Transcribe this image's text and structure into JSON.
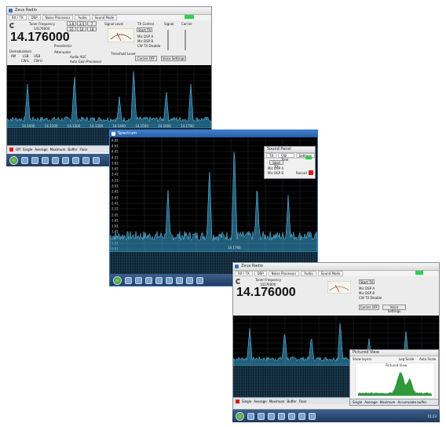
{
  "window1": {
    "title": "Zeus Radio",
    "menus": [
      "RX / TX",
      "DSP",
      "Noise Processor",
      "Audio",
      "Sound Mode"
    ],
    "tuner_label": "Tuner Frequency",
    "tuner_sub": "14176000",
    "frequency": "14.176000",
    "demodulation_label": "Demodulators",
    "modes": [
      "AM",
      "LSB",
      "USB",
      "CW-L",
      "CW-U"
    ],
    "bands": [
      "1.8",
      "3.5",
      "7",
      "10",
      "14",
      "18",
      "21",
      "24",
      "28"
    ],
    "signal_level_label": "Signal Level",
    "tx_control_label": "TX Control",
    "start_tx": "Start TX",
    "mic_dsp_a": "Mic DSP A",
    "mic_dsp_b": "Mic DSP B",
    "cw_tx_disable": "CW TX Disable",
    "signal_label": "Signal",
    "carrier_label": "Carrier",
    "preselector": "Preselector",
    "attenuator": "Attenuator",
    "auto_agc": "Audio AGC",
    "auto_gain": "Auto Gain Processor",
    "threshold_label": "Threshold Level",
    "carrier_off": "Carrier OFF",
    "voice_settings": "Voice Settings",
    "status_items": [
      "Off",
      "Single",
      "Average",
      "Maximum",
      "Buffer",
      "Floor"
    ],
    "freq_marks": [
      "14.1000",
      "14.1100",
      "14.1200",
      "14.1300",
      "14.1400",
      "14.1500",
      "14.1600",
      "14.1700"
    ]
  },
  "window2": {
    "title": "Spectrum",
    "y_ticks": [
      "4.81",
      "4.61",
      "4.41",
      "4.21",
      "3.81",
      "3.61",
      "3.41",
      "3.21",
      "3.01",
      "2.81",
      "2.61",
      "2.41",
      "2.21",
      "2.01",
      "1.81",
      "1.61",
      "1.41",
      "1.21",
      "1.01",
      "0.81"
    ],
    "center_mark": "14.1760"
  },
  "sound_panel": {
    "title": "Sound Panel",
    "tabs": [
      "TX",
      "CW Tone",
      "Settings"
    ],
    "start_tx": "Start TX",
    "options": [
      "Mic DSP A",
      "Mic DSP B"
    ],
    "record": "Record"
  },
  "window3": {
    "title": "Zeus Radio",
    "frequency": "14.176000",
    "tuner_label": "Tuner Frequency",
    "tuner_sub": "14176000",
    "menus": [
      "RX / TX",
      "DSP",
      "Noise Processor",
      "Audio",
      "Sound Mode"
    ],
    "start_tx": "Start TX",
    "mic_dsp_a": "Mic DSP A",
    "mic_dsp_b": "Mic DSP B",
    "cw_tx_disable": "CW TX Disable",
    "carrier_off": "Carrier OFF",
    "voice_settings": "Voice Settings",
    "status_items": [
      "Single",
      "Average",
      "Maximum",
      "Buffer",
      "Floor"
    ]
  },
  "pictured_view": {
    "title": "Pictured View",
    "show_layers": "Show layers",
    "log_scale": "Log Scale",
    "auto_scale": "Auto Scale",
    "chart_title": "Pictured View",
    "footer": [
      "Single",
      "Average",
      "Maximum",
      "Accumulate buffer"
    ]
  },
  "taskbar": {
    "clock": "15:23"
  }
}
